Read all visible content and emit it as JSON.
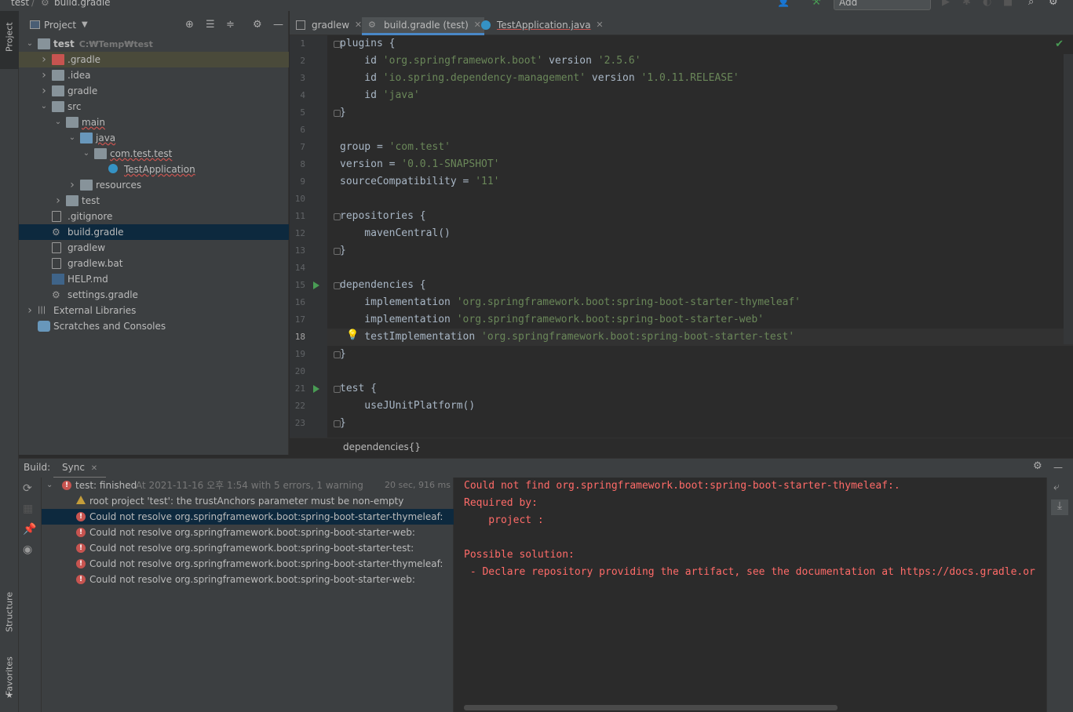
{
  "window": {
    "breadcrumb": [
      "test",
      "build.gradle"
    ],
    "add_config_label": "Add Configuration..."
  },
  "stripe": {
    "project": "Project",
    "structure": "Structure",
    "favorites": "Favorites"
  },
  "project_panel": {
    "title": "Project",
    "tree": [
      {
        "label": "test",
        "hint": "C:₩Temp₩test",
        "depth": 0,
        "arrow": "open",
        "icon": "folder"
      },
      {
        "label": ".gradle",
        "depth": 1,
        "arrow": "closed",
        "icon": "folder-red",
        "highlight": true
      },
      {
        "label": ".idea",
        "depth": 1,
        "arrow": "closed",
        "icon": "folder"
      },
      {
        "label": "gradle",
        "depth": 1,
        "arrow": "closed",
        "icon": "folder"
      },
      {
        "label": "src",
        "depth": 1,
        "arrow": "open",
        "icon": "folder"
      },
      {
        "label": "main",
        "depth": 2,
        "arrow": "open",
        "icon": "folder"
      },
      {
        "label": "java",
        "depth": 3,
        "arrow": "open",
        "icon": "folder-blue"
      },
      {
        "label": "com.test.test",
        "depth": 4,
        "arrow": "open",
        "icon": "package"
      },
      {
        "label": "TestApplication",
        "depth": 5,
        "arrow": "none",
        "icon": "class"
      },
      {
        "label": "resources",
        "depth": 3,
        "arrow": "closed",
        "icon": "folder"
      },
      {
        "label": "test",
        "depth": 2,
        "arrow": "closed",
        "icon": "folder"
      },
      {
        "label": ".gitignore",
        "depth": 1,
        "arrow": "none",
        "icon": "file"
      },
      {
        "label": "build.gradle",
        "depth": 1,
        "arrow": "none",
        "icon": "gradle",
        "selected": true
      },
      {
        "label": "gradlew",
        "depth": 1,
        "arrow": "none",
        "icon": "file"
      },
      {
        "label": "gradlew.bat",
        "depth": 1,
        "arrow": "none",
        "icon": "file"
      },
      {
        "label": "HELP.md",
        "depth": 1,
        "arrow": "none",
        "icon": "md"
      },
      {
        "label": "settings.gradle",
        "depth": 1,
        "arrow": "none",
        "icon": "gradle"
      },
      {
        "label": "External Libraries",
        "depth": 0,
        "arrow": "closed",
        "icon": "lib"
      },
      {
        "label": "Scratches and Consoles",
        "depth": 0,
        "arrow": "none",
        "icon": "scratch"
      }
    ]
  },
  "tabs": [
    {
      "label": "gradlew",
      "active": false
    },
    {
      "label": "build.gradle (test)",
      "active": true
    },
    {
      "label": "TestApplication.java",
      "active": false
    }
  ],
  "editor": {
    "current_line": 18,
    "lines": [
      [
        {
          "t": "plugins {",
          "c": ""
        }
      ],
      [
        {
          "t": "    id ",
          "c": ""
        },
        {
          "t": "'org.springframework.boot'",
          "c": "str"
        },
        {
          "t": " version ",
          "c": ""
        },
        {
          "t": "'2.5.6'",
          "c": "str"
        }
      ],
      [
        {
          "t": "    id ",
          "c": ""
        },
        {
          "t": "'io.spring.dependency-management'",
          "c": "str"
        },
        {
          "t": " version ",
          "c": ""
        },
        {
          "t": "'1.0.11.RELEASE'",
          "c": "str"
        }
      ],
      [
        {
          "t": "    id ",
          "c": ""
        },
        {
          "t": "'java'",
          "c": "str"
        }
      ],
      [
        {
          "t": "}",
          "c": ""
        }
      ],
      [
        {
          "t": "",
          "c": ""
        }
      ],
      [
        {
          "t": "group = ",
          "c": ""
        },
        {
          "t": "'com.test'",
          "c": "str"
        }
      ],
      [
        {
          "t": "version = ",
          "c": ""
        },
        {
          "t": "'0.0.1-SNAPSHOT'",
          "c": "str"
        }
      ],
      [
        {
          "t": "sourceCompatibility = ",
          "c": ""
        },
        {
          "t": "'11'",
          "c": "str"
        }
      ],
      [
        {
          "t": "",
          "c": ""
        }
      ],
      [
        {
          "t": "repositories {",
          "c": ""
        }
      ],
      [
        {
          "t": "    mavenCentral()",
          "c": ""
        }
      ],
      [
        {
          "t": "}",
          "c": ""
        }
      ],
      [
        {
          "t": "",
          "c": ""
        }
      ],
      [
        {
          "t": "dependencies {",
          "c": ""
        }
      ],
      [
        {
          "t": "    implementation ",
          "c": ""
        },
        {
          "t": "'org.springframework.boot:spring-boot-starter-thymeleaf'",
          "c": "str"
        }
      ],
      [
        {
          "t": "    implementation ",
          "c": ""
        },
        {
          "t": "'org.springframework.boot:spring-boot-starter-web'",
          "c": "str"
        }
      ],
      [
        {
          "t": "    testImplementation ",
          "c": ""
        },
        {
          "t": "'org.springframework.boot:spring-boot-starter-test'",
          "c": "str"
        }
      ],
      [
        {
          "t": "}",
          "c": ""
        }
      ],
      [
        {
          "t": "",
          "c": ""
        }
      ],
      [
        {
          "t": "test {",
          "c": ""
        }
      ],
      [
        {
          "t": "    useJUnitPlatform()",
          "c": ""
        }
      ],
      [
        {
          "t": "}",
          "c": ""
        }
      ]
    ],
    "fold_lines": [
      1,
      5,
      11,
      13,
      15,
      19,
      21,
      23
    ],
    "run_lines": [
      15,
      21
    ],
    "bulb_line": 18,
    "breadcrumb": "dependencies{}"
  },
  "build": {
    "label": "Build:",
    "tab": "Sync",
    "summary": {
      "title": "test: finished",
      "detail": "At 2021-11-16 오후 1:54 with 5 errors, 1 warning",
      "time": "20 sec, 916 ms"
    },
    "items": [
      {
        "type": "warning",
        "text": "root project 'test': the trustAnchors parameter must be non-empty"
      },
      {
        "type": "error",
        "text": "Could not resolve org.springframework.boot:spring-boot-starter-thymeleaf:",
        "selected": true
      },
      {
        "type": "error",
        "text": "Could not resolve org.springframework.boot:spring-boot-starter-web:"
      },
      {
        "type": "error",
        "text": "Could not resolve org.springframework.boot:spring-boot-starter-test:"
      },
      {
        "type": "error",
        "text": "Could not resolve org.springframework.boot:spring-boot-starter-thymeleaf:"
      },
      {
        "type": "error",
        "text": "Could not resolve org.springframework.boot:spring-boot-starter-web:"
      }
    ],
    "console": [
      "Could not find org.springframework.boot:spring-boot-starter-thymeleaf:.",
      "Required by:",
      "    project :",
      "",
      "Possible solution:",
      " - Declare repository providing the artifact, see the documentation at https://docs.gradle.or"
    ]
  },
  "colors": {
    "accent": "#4a88c7",
    "error": "#c75450",
    "string": "#6a8759",
    "selection": "#0d293e"
  }
}
